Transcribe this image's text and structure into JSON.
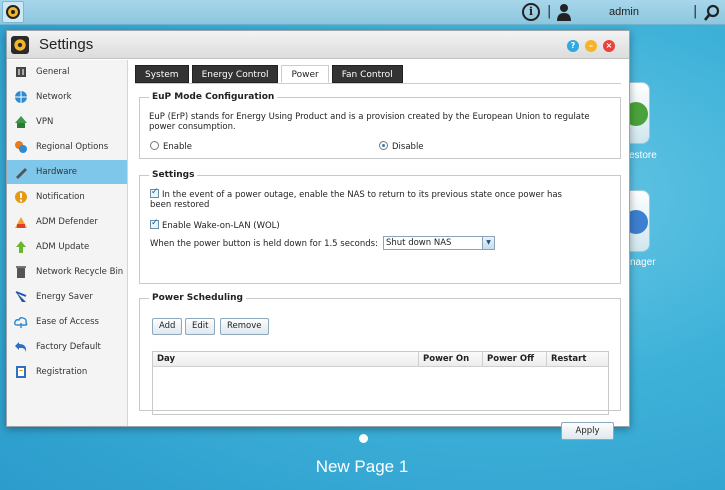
{
  "topbar": {
    "user_name": "admin",
    "separator": "|"
  },
  "desktop": {
    "icon_labels": [
      "estore",
      "nager"
    ],
    "page_label": "New Page 1"
  },
  "window": {
    "title": "Settings",
    "controls": {
      "help": "?",
      "minimize": "–",
      "close": "×"
    }
  },
  "sidebar": {
    "items": [
      {
        "label": "General",
        "icon": "general-icon"
      },
      {
        "label": "Network",
        "icon": "globe-icon"
      },
      {
        "label": "VPN",
        "icon": "vpn-icon"
      },
      {
        "label": "Regional Options",
        "icon": "regional-icon"
      },
      {
        "label": "Hardware",
        "icon": "hardware-icon",
        "active": true
      },
      {
        "label": "Notification",
        "icon": "notification-icon"
      },
      {
        "label": "ADM Defender",
        "icon": "defender-icon"
      },
      {
        "label": "ADM Update",
        "icon": "update-arrow-icon"
      },
      {
        "label": "Network Recycle Bin",
        "icon": "recycle-bin-icon"
      },
      {
        "label": "Energy Saver",
        "icon": "energy-saver-icon"
      },
      {
        "label": "Ease of Access",
        "icon": "cloud-access-icon"
      },
      {
        "label": "Factory Default",
        "icon": "undo-icon"
      },
      {
        "label": "Registration",
        "icon": "registration-icon"
      }
    ]
  },
  "tabs": [
    {
      "label": "System",
      "active": false
    },
    {
      "label": "Energy Control",
      "active": false
    },
    {
      "label": "Power",
      "active": true
    },
    {
      "label": "Fan Control",
      "active": false
    }
  ],
  "eup": {
    "legend": "EuP Mode Configuration",
    "description_line1": "EuP (ErP) stands for Energy Using Product and is a provision created by the European Union to regulate",
    "description_line2": "power consumption.",
    "enable_label": "Enable",
    "disable_label": "Disable",
    "selected": "Disable"
  },
  "settings": {
    "legend": "Settings",
    "restore_line1": "In the event of a power outage, enable the NAS to return to its previous state once power has",
    "restore_line2": "been restored",
    "restore_checked": true,
    "wol_label": "Enable Wake-on-LAN (WOL)",
    "wol_checked": true,
    "power_button_label": "When the power button is held down for 1.5 seconds:",
    "power_button_value": "Shut down NAS"
  },
  "scheduling": {
    "legend": "Power Scheduling",
    "add_label": "Add",
    "edit_label": "Edit",
    "remove_label": "Remove",
    "columns": [
      "Day",
      "Power On",
      "Power Off",
      "Restart"
    ],
    "rows": []
  },
  "footer": {
    "apply_label": "Apply"
  },
  "colors": {
    "sidebar_active": "#7ec7ea",
    "tab_inactive": "#333333",
    "close_button": "#e8433a",
    "minimize_button": "#f5b52b",
    "help_button": "#30a8e0"
  }
}
